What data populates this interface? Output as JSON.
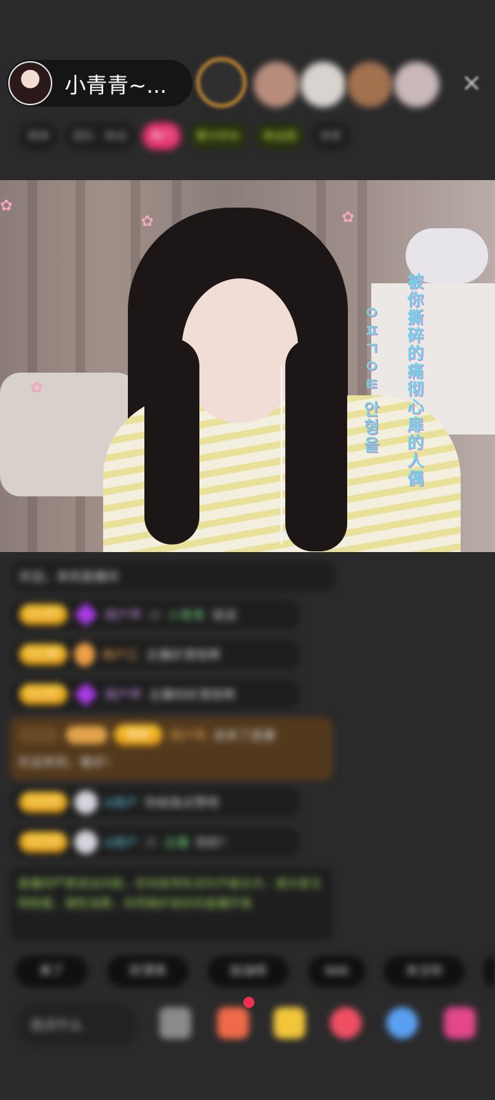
{
  "header": {
    "host_name": "小青青~...",
    "close_icon": "×",
    "info_chips": [
      "榜单",
      "团队 · 粉丝",
      "热门",
      "累计时长",
      "粉丝团",
      "亲密",
      "粉丝榜",
      "···"
    ]
  },
  "video": {
    "lyric_cn": "被你撕碎的痛彻心扉的人偶",
    "lyric_kr": "ㅇㅍㄱㅇㅌ 안형을"
  },
  "chat": {
    "intro": "欢迎，来到直播间",
    "messages": [
      {
        "level": "Lv.21",
        "name": "用户甲",
        "sep": "对",
        "target": "小青青",
        "text": "说话"
      },
      {
        "level": "Lv.36",
        "name": "用户乙",
        "text": "主播好漂亮啊"
      },
      {
        "level": "Lv.21",
        "name": "用户甲",
        "text": "主播你好漂亮啊"
      },
      {
        "level": "Lv.12",
        "name": "A用户",
        "text": "你给我点赞吧"
      },
      {
        "level": "Lv.12",
        "name": "A用户",
        "sep": "对",
        "target": "主播",
        "text": "你好！"
      }
    ],
    "featured": {
      "badge": "粉丝",
      "name": "用户丙",
      "text": "进来了直播",
      "text2": "欢迎来到，看好！"
    },
    "system": "直播间严禁违法内容，任何宣传形式均不被允许，请大家文明观看、理性消费，共同维护良好的直播环境"
  },
  "quick_replies": [
    "来了",
    "好漂亮",
    "加油呀",
    "666",
    "关注你"
  ],
  "bottom": {
    "input_placeholder": "说点什么"
  },
  "colors": {
    "background": "#2a2a2b",
    "level_badge": "#f2b325",
    "lyric": "#6fd6e6"
  }
}
